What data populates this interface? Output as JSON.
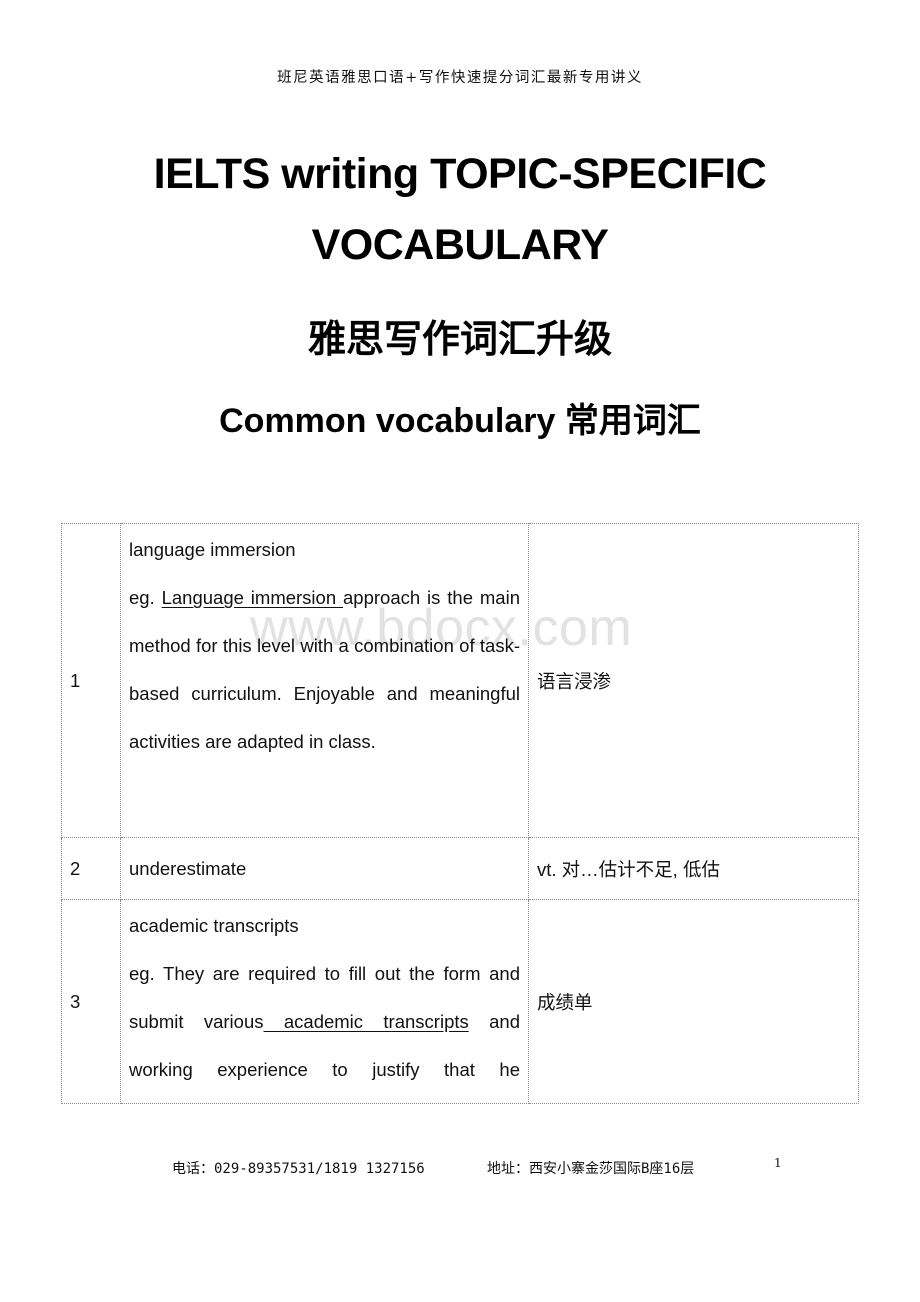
{
  "header": {
    "text": "班尼英语雅思口语+写作快速提分词汇最新专用讲义"
  },
  "titles": {
    "line1": "IELTS writing TOPIC-SPECIFIC",
    "line2": "VOCABULARY",
    "line3": "雅思写作词汇升级",
    "line4": "Common vocabulary  常用词汇"
  },
  "watermark": "www.bdocx.com",
  "table": {
    "rows": [
      {
        "number": "1",
        "term": "language immersion",
        "example_prefix": "eg. ",
        "example_highlight": "Language immersion ",
        "example_suffix": "approach is the main method for this level with a combination of task-based curriculum. Enjoyable and meaningful activities are adapted in class.",
        "meaning": "语言浸渗"
      },
      {
        "number": "2",
        "term": "underestimate",
        "meaning": "vt. 对…估计不足, 低估"
      },
      {
        "number": "3",
        "term": "academic transcripts",
        "example_prefix": "eg. They are required to fill out the form and submit various",
        "example_highlight": " academic transcripts",
        "example_suffix": " and working experience to justify that he",
        "meaning": "成绩单"
      }
    ]
  },
  "footer": {
    "phone": "电话：029-89357531/1819 1327156",
    "address": "地址：西安小寨金莎国际B座16层",
    "page_number": "1"
  }
}
